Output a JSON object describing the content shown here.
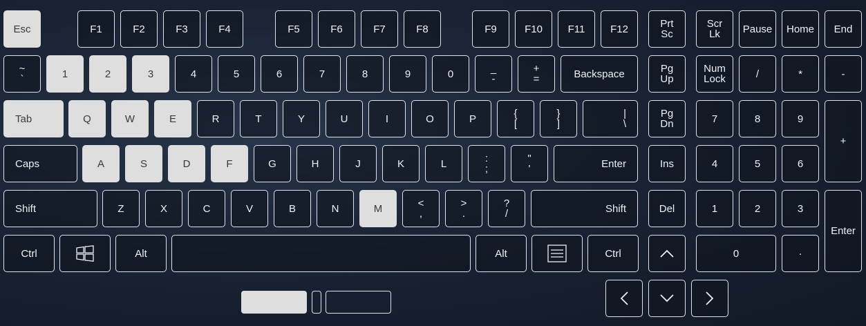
{
  "keyboard": {
    "keys": [
      {
        "id": "esc",
        "label": "Esc",
        "hl": true
      },
      {
        "id": "f1",
        "label": "F1"
      },
      {
        "id": "f2",
        "label": "F2"
      },
      {
        "id": "f3",
        "label": "F3"
      },
      {
        "id": "f4",
        "label": "F4"
      },
      {
        "id": "f5",
        "label": "F5"
      },
      {
        "id": "f6",
        "label": "F6"
      },
      {
        "id": "f7",
        "label": "F7"
      },
      {
        "id": "f8",
        "label": "F8"
      },
      {
        "id": "f9",
        "label": "F9"
      },
      {
        "id": "f10",
        "label": "F10"
      },
      {
        "id": "f11",
        "label": "F11"
      },
      {
        "id": "f12",
        "label": "F12"
      },
      {
        "id": "prtsc",
        "label": "Prt",
        "label2": "Sc"
      },
      {
        "id": "scrlk",
        "label": "Scr",
        "label2": "Lk"
      },
      {
        "id": "pause",
        "label": "Pause"
      },
      {
        "id": "home",
        "label": "Home"
      },
      {
        "id": "end",
        "label": "End"
      },
      {
        "id": "backtick",
        "label": "~",
        "label2": "`"
      },
      {
        "id": "1",
        "label": "1",
        "hl": true
      },
      {
        "id": "2",
        "label": "2",
        "hl": true
      },
      {
        "id": "3",
        "label": "3",
        "hl": true
      },
      {
        "id": "4",
        "label": "4"
      },
      {
        "id": "5",
        "label": "5"
      },
      {
        "id": "6",
        "label": "6"
      },
      {
        "id": "7",
        "label": "7"
      },
      {
        "id": "8",
        "label": "8"
      },
      {
        "id": "9",
        "label": "9"
      },
      {
        "id": "0",
        "label": "0"
      },
      {
        "id": "minus",
        "label": "_",
        "label2": "-"
      },
      {
        "id": "equals",
        "label": "+",
        "label2": "="
      },
      {
        "id": "backspace",
        "label": "Backspace"
      },
      {
        "id": "pgup",
        "label": "Pg",
        "label2": "Up"
      },
      {
        "id": "numlock",
        "label": "Num",
        "label2": "Lock"
      },
      {
        "id": "np-div",
        "label": "/"
      },
      {
        "id": "np-mul",
        "label": "*"
      },
      {
        "id": "np-sub",
        "label": "-"
      },
      {
        "id": "tab",
        "label": "Tab",
        "hl": true
      },
      {
        "id": "q",
        "label": "Q",
        "hl": true
      },
      {
        "id": "w",
        "label": "W",
        "hl": true
      },
      {
        "id": "e",
        "label": "E",
        "hl": true
      },
      {
        "id": "r",
        "label": "R"
      },
      {
        "id": "t",
        "label": "T"
      },
      {
        "id": "y",
        "label": "Y"
      },
      {
        "id": "u",
        "label": "U"
      },
      {
        "id": "i",
        "label": "I"
      },
      {
        "id": "o",
        "label": "O"
      },
      {
        "id": "p",
        "label": "P"
      },
      {
        "id": "lbracket",
        "label": "{",
        "label2": "["
      },
      {
        "id": "rbracket",
        "label": "}",
        "label2": "]"
      },
      {
        "id": "backslash",
        "label": "|",
        "label2": "\\"
      },
      {
        "id": "pgdn",
        "label": "Pg",
        "label2": "Dn"
      },
      {
        "id": "np7",
        "label": "7"
      },
      {
        "id": "np8",
        "label": "8"
      },
      {
        "id": "np9",
        "label": "9"
      },
      {
        "id": "np-add",
        "label": "+"
      },
      {
        "id": "caps",
        "label": "Caps"
      },
      {
        "id": "a",
        "label": "A",
        "hl": true
      },
      {
        "id": "s",
        "label": "S",
        "hl": true
      },
      {
        "id": "d",
        "label": "D",
        "hl": true
      },
      {
        "id": "f",
        "label": "F",
        "hl": true
      },
      {
        "id": "g",
        "label": "G"
      },
      {
        "id": "h",
        "label": "H"
      },
      {
        "id": "j",
        "label": "J"
      },
      {
        "id": "k",
        "label": "K"
      },
      {
        "id": "l",
        "label": "L"
      },
      {
        "id": "semicolon",
        "label": ":",
        "label2": ";"
      },
      {
        "id": "quote",
        "label": "\"",
        "label2": "'"
      },
      {
        "id": "enter",
        "label": "Enter"
      },
      {
        "id": "ins",
        "label": "Ins"
      },
      {
        "id": "np4",
        "label": "4"
      },
      {
        "id": "np5",
        "label": "5"
      },
      {
        "id": "np6",
        "label": "6"
      },
      {
        "id": "lshift",
        "label": "Shift"
      },
      {
        "id": "z",
        "label": "Z"
      },
      {
        "id": "x",
        "label": "X"
      },
      {
        "id": "c",
        "label": "C"
      },
      {
        "id": "v",
        "label": "V"
      },
      {
        "id": "b",
        "label": "B"
      },
      {
        "id": "n",
        "label": "N"
      },
      {
        "id": "m",
        "label": "M",
        "hl": true
      },
      {
        "id": "comma",
        "label": "<",
        "label2": ","
      },
      {
        "id": "period",
        "label": ">",
        "label2": "."
      },
      {
        "id": "slash",
        "label": "?",
        "label2": "/"
      },
      {
        "id": "rshift",
        "label": "Shift"
      },
      {
        "id": "del",
        "label": "Del"
      },
      {
        "id": "np1",
        "label": "1"
      },
      {
        "id": "np2",
        "label": "2"
      },
      {
        "id": "np3",
        "label": "3"
      },
      {
        "id": "np-enter",
        "label": "Enter"
      },
      {
        "id": "lctrl",
        "label": "Ctrl"
      },
      {
        "id": "win",
        "icon": "windows-icon"
      },
      {
        "id": "lalt",
        "label": "Alt"
      },
      {
        "id": "space",
        "label": ""
      },
      {
        "id": "ralt",
        "label": "Alt"
      },
      {
        "id": "menu",
        "icon": "menu-icon"
      },
      {
        "id": "rctrl",
        "label": "Ctrl"
      },
      {
        "id": "up",
        "icon": "arrow-up-icon"
      },
      {
        "id": "np0",
        "label": "0"
      },
      {
        "id": "np-dec",
        "label": "·"
      },
      {
        "id": "left",
        "icon": "arrow-left-icon"
      },
      {
        "id": "down",
        "icon": "arrow-down-icon"
      },
      {
        "id": "right",
        "icon": "arrow-right-icon"
      }
    ],
    "colors": {
      "key_border": "#dfe4ec",
      "key_highlight": "#dedede",
      "key_text": "#eef1f5",
      "highlight_text": "#3a3a3a"
    }
  }
}
